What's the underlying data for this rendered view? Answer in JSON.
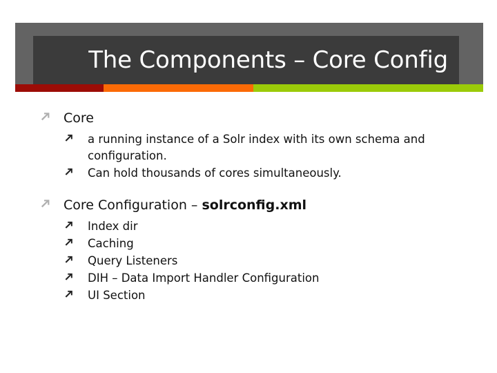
{
  "slide": {
    "title": "The Components – Core Config",
    "accent_colors": {
      "banner_gray": "#636363",
      "plate_dark": "#3b3b3b",
      "stripe_red": "#9c0c06",
      "stripe_orange": "#fb6a06",
      "stripe_green": "#9bcb09",
      "title_text": "#ffffff",
      "body_text": "#111111",
      "bullet_level1": "#b0b0b0",
      "bullet_level2": "#222222"
    },
    "bullet_icon_level1": "arrow-up-right-icon",
    "bullet_icon_level2": "arrow-up-right-icon",
    "content": [
      {
        "label": "Core",
        "children": [
          {
            "label": "a running instance of a Solr index with its own schema and configuration."
          },
          {
            "label": "Can hold thousands of cores simultaneously."
          }
        ]
      },
      {
        "label": "Core Configuration – ",
        "label_bold": "solrconfig.xml",
        "children": [
          {
            "label": "Index dir"
          },
          {
            "label": "Caching"
          },
          {
            "label": "Query Listeners"
          },
          {
            "label": "DIH – Data Import Handler Configuration"
          },
          {
            "label": "UI Section"
          }
        ]
      }
    ]
  }
}
